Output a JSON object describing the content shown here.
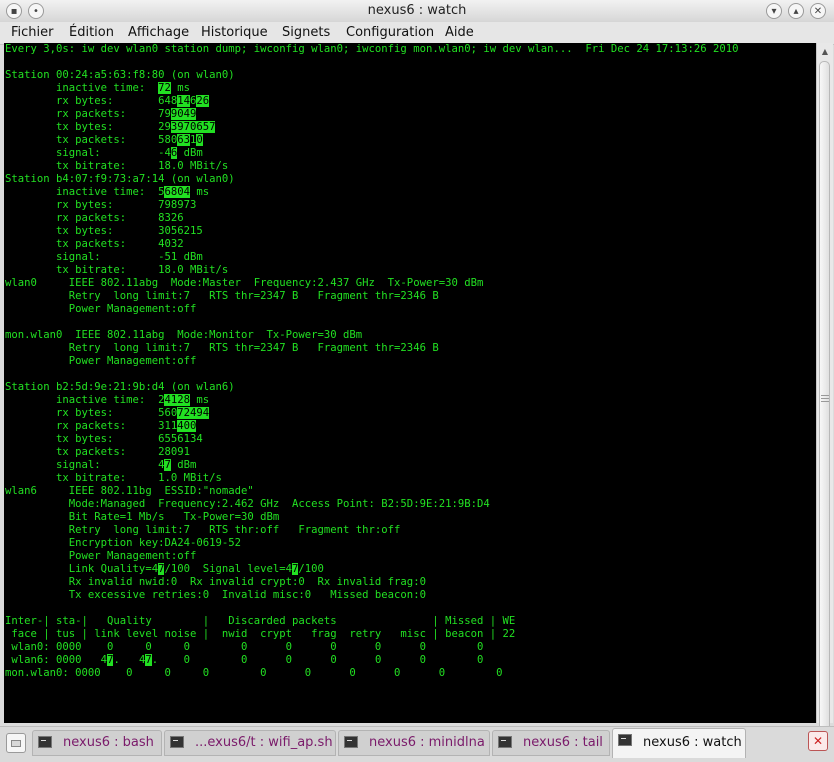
{
  "window": {
    "title": "nexus6 : watch"
  },
  "menubar": {
    "items": [
      "Fichier",
      "Édition",
      "Affichage",
      "Historique",
      "Signets",
      "Configuration",
      "Aide"
    ]
  },
  "terminal": {
    "lines": [
      [
        [
          "Every 3,0s: iw dev wlan0 station dump; iwconfig wlan0; iwconfig mon.wlan0; iw dev wlan...  Fri Dec 24 17:13:26 2010",
          0
        ]
      ],
      [
        [
          "",
          0
        ]
      ],
      [
        [
          "Station 00:24:a5:63:f8:80 (on wlan0)",
          0
        ]
      ],
      [
        [
          "        inactive time:  ",
          0
        ],
        [
          "72",
          1
        ],
        [
          " ms",
          0
        ]
      ],
      [
        [
          "        rx bytes:       648",
          0
        ],
        [
          "14",
          1
        ],
        [
          "6",
          0
        ],
        [
          "26",
          1
        ]
      ],
      [
        [
          "        rx packets:     79",
          0
        ],
        [
          "9049",
          1
        ]
      ],
      [
        [
          "        tx bytes:       29",
          0
        ],
        [
          "3970657",
          1
        ]
      ],
      [
        [
          "        tx packets:     580",
          0
        ],
        [
          "63",
          1
        ],
        [
          "1",
          0
        ],
        [
          "0",
          1
        ]
      ],
      [
        [
          "        signal:         -4",
          0
        ],
        [
          "6",
          1
        ],
        [
          " dBm",
          0
        ]
      ],
      [
        [
          "        tx bitrate:     18.0 MBit/s",
          0
        ]
      ],
      [
        [
          "Station b4:07:f9:73:a7:14 (on wlan0)",
          0
        ]
      ],
      [
        [
          "        inactive time:  5",
          0
        ],
        [
          "6804",
          1
        ],
        [
          " ms",
          0
        ]
      ],
      [
        [
          "        rx bytes:       798973",
          0
        ]
      ],
      [
        [
          "        rx packets:     8326",
          0
        ]
      ],
      [
        [
          "        tx bytes:       3056215",
          0
        ]
      ],
      [
        [
          "        tx packets:     4032",
          0
        ]
      ],
      [
        [
          "        signal:         -51 dBm",
          0
        ]
      ],
      [
        [
          "        tx bitrate:     18.0 MBit/s",
          0
        ]
      ],
      [
        [
          "wlan0     IEEE 802.11abg  Mode:Master  Frequency:2.437 GHz  Tx-Power=30 dBm",
          0
        ]
      ],
      [
        [
          "          Retry  long limit:7   RTS thr=2347 B   Fragment thr=2346 B",
          0
        ]
      ],
      [
        [
          "          Power Management:off",
          0
        ]
      ],
      [
        [
          "",
          0
        ]
      ],
      [
        [
          "mon.wlan0  IEEE 802.11abg  Mode:Monitor  Tx-Power=30 dBm",
          0
        ]
      ],
      [
        [
          "          Retry  long limit:7   RTS thr=2347 B   Fragment thr=2346 B",
          0
        ]
      ],
      [
        [
          "          Power Management:off",
          0
        ]
      ],
      [
        [
          "",
          0
        ]
      ],
      [
        [
          "Station b2:5d:9e:21:9b:d4 (on wlan6)",
          0
        ]
      ],
      [
        [
          "        inactive time:  2",
          0
        ],
        [
          "4128",
          1
        ],
        [
          " ms",
          0
        ]
      ],
      [
        [
          "        rx bytes:       560",
          0
        ],
        [
          "72494",
          1
        ]
      ],
      [
        [
          "        rx packets:     311",
          0
        ],
        [
          "400",
          1
        ]
      ],
      [
        [
          "        tx bytes:       6556134",
          0
        ]
      ],
      [
        [
          "        tx packets:     28091",
          0
        ]
      ],
      [
        [
          "        signal:         4",
          0
        ],
        [
          "7",
          1
        ],
        [
          " dBm",
          0
        ]
      ],
      [
        [
          "        tx bitrate:     1.0 MBit/s",
          0
        ]
      ],
      [
        [
          "wlan6     IEEE 802.11bg  ESSID:\"nomade\"",
          0
        ]
      ],
      [
        [
          "          Mode:Managed  Frequency:2.462 GHz  Access Point: B2:5D:9E:21:9B:D4",
          0
        ]
      ],
      [
        [
          "          Bit Rate=1 Mb/s   Tx-Power=30 dBm",
          0
        ]
      ],
      [
        [
          "          Retry  long limit:7   RTS thr:off   Fragment thr:off",
          0
        ]
      ],
      [
        [
          "          Encryption key:DA24-0619-52",
          0
        ]
      ],
      [
        [
          "          Power Management:off",
          0
        ]
      ],
      [
        [
          "          Link Quality=4",
          0
        ],
        [
          "7",
          1
        ],
        [
          "/100  Signal level=4",
          0
        ],
        [
          "7",
          1
        ],
        [
          "/100",
          0
        ]
      ],
      [
        [
          "          Rx invalid nwid:0  Rx invalid crypt:0  Rx invalid frag:0",
          0
        ]
      ],
      [
        [
          "          Tx excessive retries:0  Invalid misc:0   Missed beacon:0",
          0
        ]
      ],
      [
        [
          "",
          0
        ]
      ],
      [
        [
          "Inter-| sta-|   Quality        |   Discarded packets               | Missed | WE",
          0
        ]
      ],
      [
        [
          " face | tus | link level noise |  nwid  crypt   frag  retry   misc | beacon | 22",
          0
        ]
      ],
      [
        [
          " wlan0: 0000    0     0     0        0      0      0      0      0        0",
          0
        ]
      ],
      [
        [
          " wlan6: 0000   4",
          0
        ],
        [
          "7",
          1
        ],
        [
          ".   4",
          0
        ],
        [
          "7",
          1
        ],
        [
          ".    0        0      0      0      0      0        0",
          0
        ]
      ],
      [
        [
          "mon.wlan0: 0000    0     0     0        0      0      0      0      0        0",
          0
        ]
      ]
    ]
  },
  "tabs": [
    {
      "label": "nexus6 : bash",
      "active": false
    },
    {
      "label": "...exus6/t : wifi_ap.sh",
      "active": false
    },
    {
      "label": "nexus6 : minidlna",
      "active": false
    },
    {
      "label": "nexus6 : tail",
      "active": false
    },
    {
      "label": "nexus6 : watch",
      "active": true
    }
  ],
  "icons": {
    "window_menu": "terminal-window-icon",
    "pin": "pin-icon",
    "minimize": "chevron-down-icon",
    "maximize": "chevron-up-icon",
    "close": "close-icon",
    "new_tab": "new-tab-icon",
    "close_tab": "close-tab-icon"
  },
  "colors": {
    "terminal_fg": "#22e022",
    "terminal_bg": "#000000",
    "highlight_bg": "#22e022"
  }
}
